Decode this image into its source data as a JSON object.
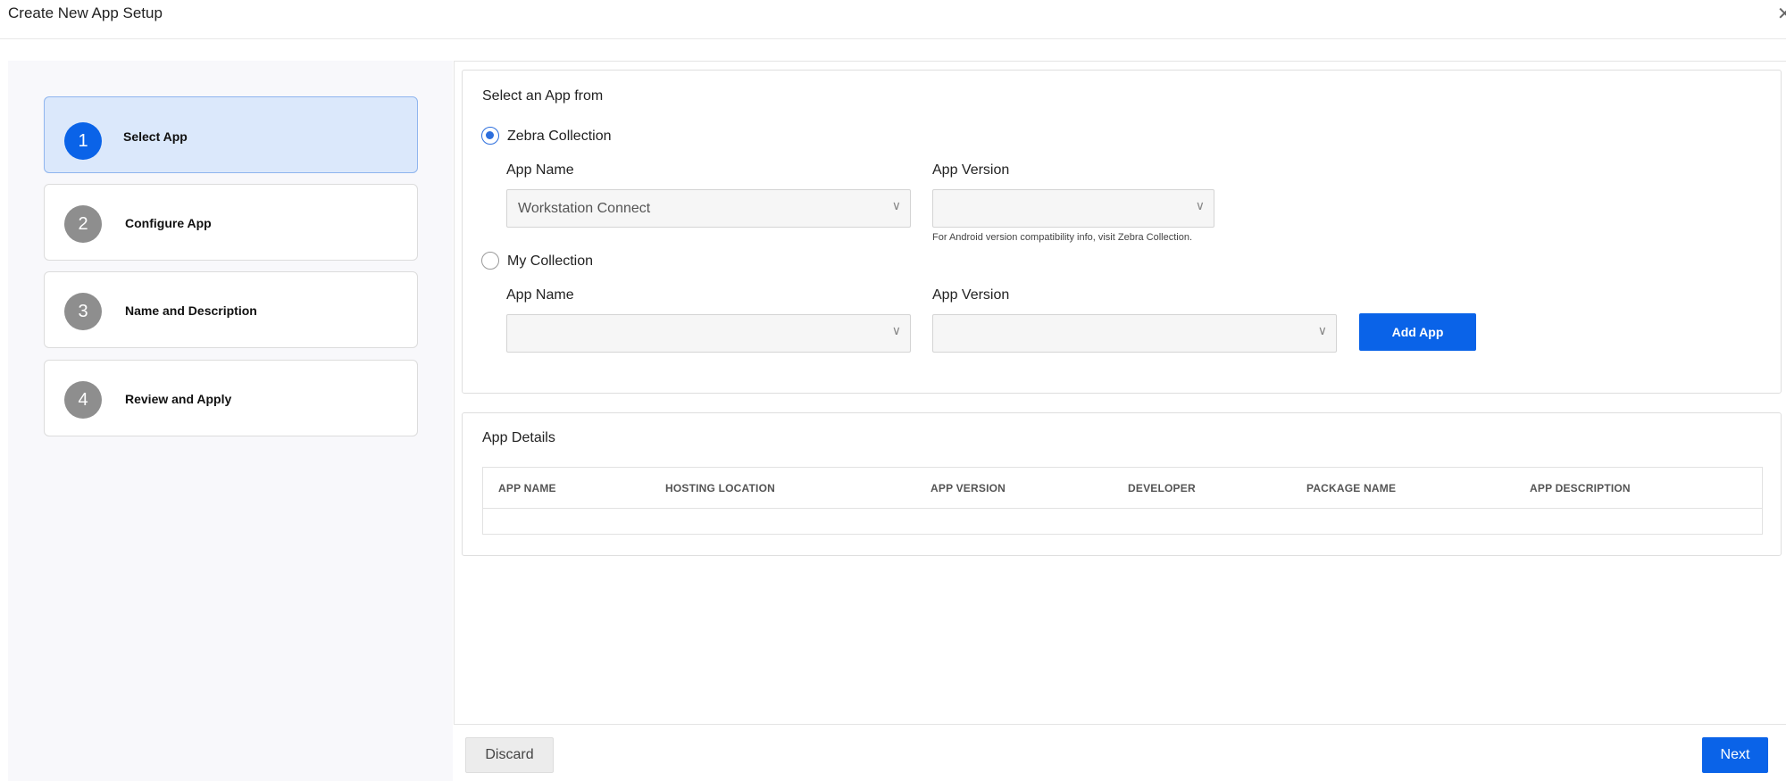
{
  "window": {
    "title": "Create New App Setup",
    "close_glyph": "✕",
    "close_icon": "close-icon"
  },
  "steps": [
    {
      "number": "1",
      "label": "Select App",
      "active": true
    },
    {
      "number": "2",
      "label": "Configure App",
      "active": false
    },
    {
      "number": "3",
      "label": "Name and Description",
      "active": false
    },
    {
      "number": "4",
      "label": "Review and Apply",
      "active": false
    }
  ],
  "select_app": {
    "title": "Select an App from",
    "zebra_collection": {
      "label": "Zebra Collection",
      "selected": true,
      "app_name_label": "App Name",
      "app_name_value": "Workstation Connect",
      "app_version_label": "App Version",
      "app_version_value": "",
      "hint": "For Android version compatibility info, visit Zebra Collection."
    },
    "my_collection": {
      "label": "My Collection",
      "selected": false,
      "app_name_label": "App Name",
      "app_name_value": "",
      "app_version_label": "App Version",
      "app_version_value": "",
      "add_app_label": "Add App"
    }
  },
  "app_details": {
    "title": "App Details",
    "columns": [
      "APP NAME",
      "HOSTING LOCATION",
      "APP VERSION",
      "DEVELOPER",
      "PACKAGE NAME",
      "APP DESCRIPTION"
    ],
    "rows": []
  },
  "footer": {
    "discard_label": "Discard",
    "next_label": "Next"
  },
  "icons": {
    "chevron": "∨"
  },
  "colors": {
    "primary": "#0a63e8",
    "active_step_bg": "#dbe8fb",
    "inactive_step_badge": "#8e8e8e"
  }
}
